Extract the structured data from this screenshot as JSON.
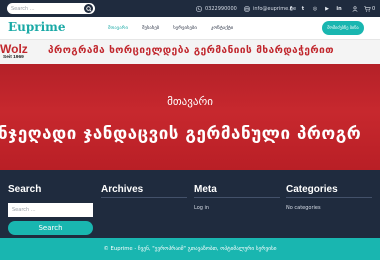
{
  "topbar": {
    "search_placeholder": "Search ...",
    "phone": "0322990000",
    "email": "info@euprime.ge",
    "social": [
      {
        "icon": "facebook-icon",
        "glyph": "f"
      },
      {
        "icon": "twitter-icon",
        "glyph": "t"
      },
      {
        "icon": "instagram-icon",
        "glyph": "◎"
      },
      {
        "icon": "youtube-icon",
        "glyph": "▶"
      },
      {
        "icon": "linkedin-icon",
        "glyph": "in"
      }
    ],
    "cart_count": "0"
  },
  "header": {
    "logo": "Euprime",
    "nav": [
      "მთავარი",
      "შესახებ",
      "სერვისები",
      "კონტაქტი"
    ],
    "cta": "მომიძებნე ბინა"
  },
  "hero": {
    "brand_name": "Wolz",
    "brand_sub": "Seit 1969",
    "line1": "პროგრამა ხორციელდება გერმანიის მხარდაჭერით",
    "line2": "ნჯეღადი ჯანდაცვის გერმანული პროგრ",
    "title": "მთავარი"
  },
  "widgets": {
    "search": {
      "title": "Search",
      "placeholder": "Search ...",
      "button": "Search"
    },
    "archives": {
      "title": "Archives"
    },
    "meta": {
      "title": "Meta",
      "link": "Log in"
    },
    "categories": {
      "title": "Categories",
      "text": "No categories"
    }
  },
  "footer": {
    "text": "© Euprime - ჩვენ, \"ევროპრაიმ\" გთავაზობთ, ოპტიმალური სერვისი"
  },
  "colors": {
    "accent": "#19b6b0",
    "dark": "#1f2b3e",
    "hero_red": "#c1272d"
  }
}
